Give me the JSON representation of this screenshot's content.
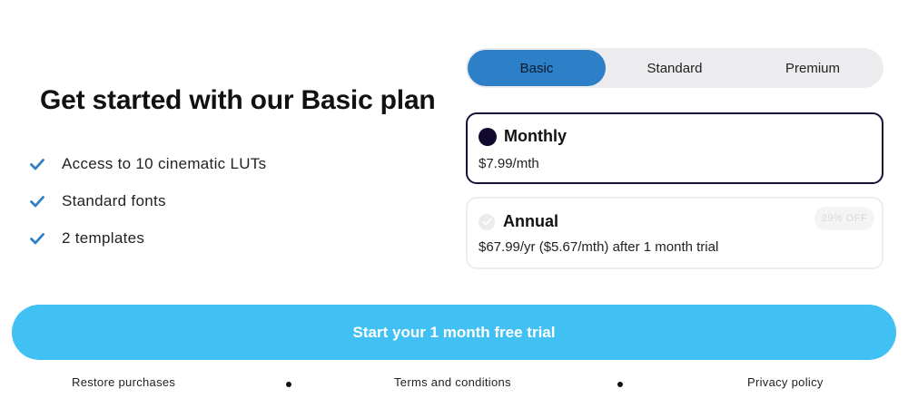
{
  "headline": "Get started with our Basic plan",
  "features": [
    {
      "icon": "check-icon",
      "text": "Access to 10 cinematic LUTs"
    },
    {
      "icon": "check-icon",
      "text": "Standard fonts"
    },
    {
      "icon": "check-icon",
      "text": "2 templates"
    }
  ],
  "plan_tabs": [
    {
      "label": "Basic",
      "selected": true
    },
    {
      "label": "Standard",
      "selected": false
    },
    {
      "label": "Premium",
      "selected": false
    }
  ],
  "plans": {
    "monthly": {
      "name": "Monthly",
      "price": "$7.99/mth",
      "selected": true
    },
    "annual": {
      "name": "Annual",
      "price": "$67.99/yr ($5.67/mth) after 1 month trial",
      "badge": "29% OFF",
      "selected": false
    }
  },
  "cta_label": "Start your 1 month free trial",
  "footer": {
    "restore": "Restore purchases",
    "terms": "Terms and conditions",
    "privacy": "Privacy policy"
  },
  "colors": {
    "accent_tab": "#2d7fc7",
    "cta": "#40c0f3",
    "check": "#2d7fc7",
    "selected_border": "#13123a"
  }
}
